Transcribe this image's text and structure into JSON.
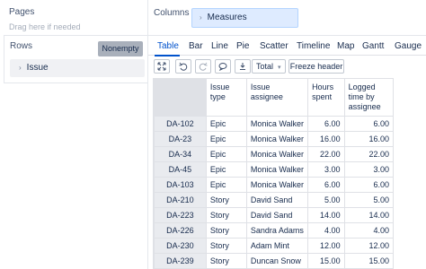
{
  "pages": {
    "title": "Pages",
    "hint": "Drag here if needed"
  },
  "rows": {
    "title": "Rows",
    "nonempty_label": "Nonempty",
    "chip_label": "Issue"
  },
  "columns": {
    "title": "Columns",
    "chip_label": "Measures"
  },
  "tabs": [
    "Table",
    "Bar",
    "Line",
    "Pie",
    "Scatter",
    "Timeline",
    "Map",
    "Gantt",
    "Gauge"
  ],
  "active_tab": "Table",
  "toolbar": {
    "total_label": "Total",
    "freeze_label": "Freeze header"
  },
  "table": {
    "headers": [
      "Issue type",
      "Issue assignee",
      "Hours spent",
      "Logged time by assignee"
    ],
    "rows": [
      {
        "id": "DA-102",
        "type": "Epic",
        "assignee": "Monica Walker",
        "hours": "6.00",
        "logged": "6.00"
      },
      {
        "id": "DA-23",
        "type": "Epic",
        "assignee": "Monica Walker",
        "hours": "16.00",
        "logged": "16.00"
      },
      {
        "id": "DA-34",
        "type": "Epic",
        "assignee": "Monica Walker",
        "hours": "22.00",
        "logged": "22.00"
      },
      {
        "id": "DA-45",
        "type": "Epic",
        "assignee": "Monica Walker",
        "hours": "3.00",
        "logged": "3.00"
      },
      {
        "id": "DA-103",
        "type": "Epic",
        "assignee": "Monica Walker",
        "hours": "6.00",
        "logged": "6.00"
      },
      {
        "id": "DA-210",
        "type": "Story",
        "assignee": "David Sand",
        "hours": "5.00",
        "logged": "5.00"
      },
      {
        "id": "DA-223",
        "type": "Story",
        "assignee": "David Sand",
        "hours": "14.00",
        "logged": "14.00"
      },
      {
        "id": "DA-226",
        "type": "Story",
        "assignee": "Sandra Adams",
        "hours": "4.00",
        "logged": "4.00"
      },
      {
        "id": "DA-230",
        "type": "Story",
        "assignee": "Adam Mint",
        "hours": "12.00",
        "logged": "12.00"
      },
      {
        "id": "DA-239",
        "type": "Story",
        "assignee": "Duncan Snow",
        "hours": "15.00",
        "logged": "15.00"
      }
    ]
  },
  "colors": {
    "accent": "#0052cc",
    "chip_bg": "#deebff",
    "nonempty_bg": "#a9b0bb",
    "row_header_bg": "#e9ebef"
  },
  "icons": [
    "expand-icon",
    "undo-icon",
    "redo-icon",
    "comment-icon",
    "export-icon"
  ]
}
